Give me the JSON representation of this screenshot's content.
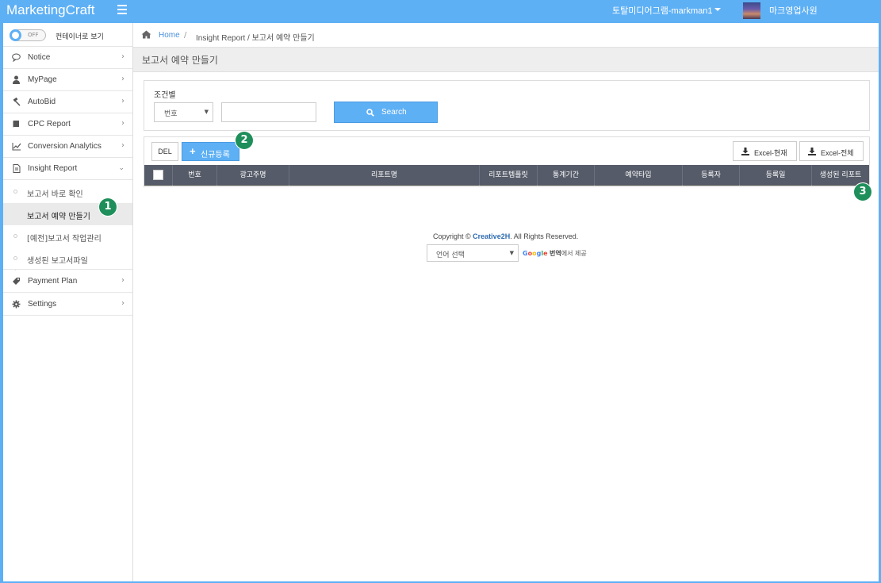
{
  "app": {
    "brand": "MarketingCraft"
  },
  "topbar": {
    "user": "토탈미디어그램-markman1",
    "role": "마크영업사원"
  },
  "sidebar": {
    "toggle_state": "OFF",
    "toggle_label": "컨테이너로 보기",
    "items": [
      {
        "label": "Notice",
        "icon": "speech-bubble-icon"
      },
      {
        "label": "MyPage",
        "icon": "user-icon"
      },
      {
        "label": "AutoBid",
        "icon": "gavel-icon"
      },
      {
        "label": "CPC Report",
        "icon": "book-icon"
      },
      {
        "label": "Conversion Analytics",
        "icon": "line-chart-icon"
      },
      {
        "label": "Insight Report",
        "icon": "document-icon"
      }
    ],
    "sub_items": [
      {
        "label": "보고서 바로 확인"
      },
      {
        "label": "보고서 예약 만들기"
      },
      {
        "label": "[예전]보고서 작업관리"
      },
      {
        "label": "생성된 보고서파일"
      }
    ],
    "items_after": [
      {
        "label": "Payment Plan",
        "icon": "tag-icon"
      },
      {
        "label": "Settings",
        "icon": "gear-icon"
      }
    ]
  },
  "breadcrumb": {
    "home": "Home",
    "separator": "/",
    "path": "Insight Report / 보고서 예약 만들기"
  },
  "page": {
    "title": "보고서 예약 만들기"
  },
  "search": {
    "label": "조건별",
    "select_value": "번호",
    "input_value": "",
    "button": "Search"
  },
  "toolbar": {
    "del": "DEL",
    "new": "신규등록",
    "excel_current": "Excel-현재",
    "excel_all": "Excel-전체"
  },
  "table": {
    "columns": [
      "번호",
      "광고주명",
      "리포트명",
      "리포트템플릿",
      "통계기간",
      "예약타입",
      "등록자",
      "등록일",
      "생성된 리포트"
    ]
  },
  "footer": {
    "copyright_prefix": "Copyright ©",
    "company": "Creative2H",
    "copyright_suffix": ". All Rights Reserved.",
    "language_select": "언어 선택",
    "translate_text": "번역",
    "provided_by": "에서 제공"
  },
  "annotations": {
    "badge1": "1",
    "badge2": "2",
    "badge3": "3"
  },
  "colors": {
    "accent": "#5eb0f5",
    "table_header": "#555b68",
    "badge": "#1e8f5a"
  }
}
